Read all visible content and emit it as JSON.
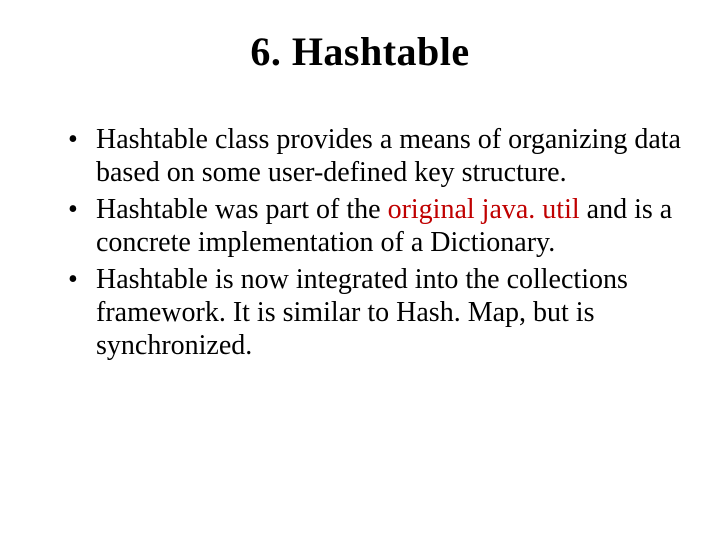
{
  "title": "6.  Hashtable",
  "bullets": [
    {
      "pre": "Hashtable class provides a means of organizing data based on some user-defined key structure.",
      "accent": "",
      "post": ""
    },
    {
      "pre": "Hashtable was part of the ",
      "accent": "original java. util",
      "post": " and is a concrete implementation of a Dictionary."
    },
    {
      "pre": "Hashtable is now integrated into the collections framework. It is similar to Hash. Map, but is synchronized.",
      "accent": "",
      "post": ""
    }
  ]
}
